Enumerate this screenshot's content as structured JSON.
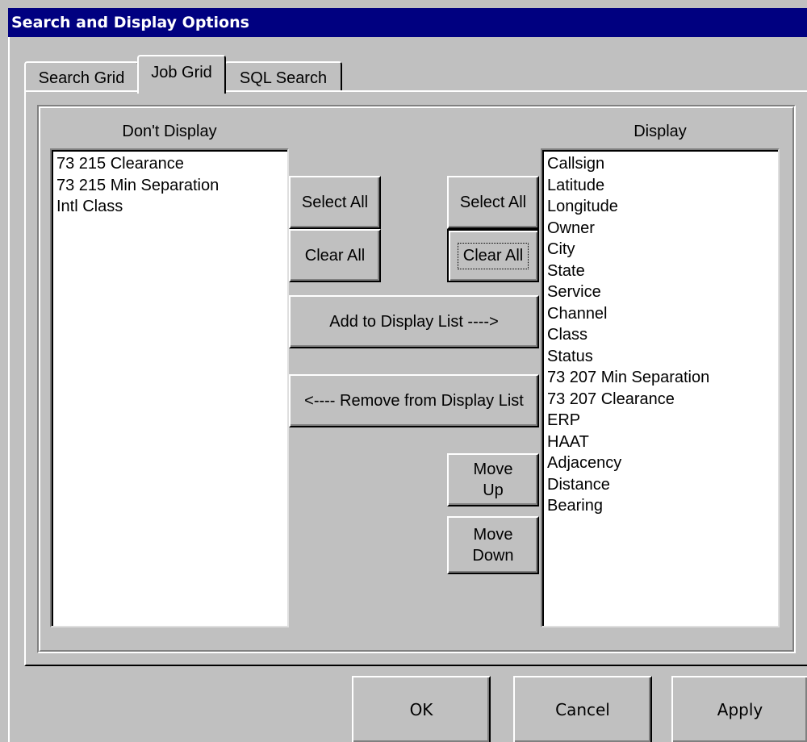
{
  "window": {
    "title": "Search and Display Options"
  },
  "tabs": [
    {
      "label": "Search Grid",
      "active": false
    },
    {
      "label": "Job Grid",
      "active": true
    },
    {
      "label": "SQL Search",
      "active": false
    }
  ],
  "left_panel": {
    "label": "Don't Display",
    "items": [
      "73 215 Clearance",
      "73 215 Min Separation",
      "Intl Class"
    ]
  },
  "right_panel": {
    "label": "Display",
    "items": [
      "Callsign",
      "Latitude",
      "Longitude",
      "Owner",
      "City",
      "State",
      "Service",
      "Channel",
      "Class",
      "Status",
      "73 207 Min Separation",
      "73 207 Clearance",
      "ERP",
      "HAAT",
      "Adjacency",
      "Distance",
      "Bearing"
    ]
  },
  "buttons": {
    "select_all_left": "Select All",
    "clear_all_left": "Clear All",
    "select_all_right": "Select All",
    "clear_all_right": "Clear All",
    "add": "Add to Display List ---->",
    "remove": "<---- Remove from Display List",
    "move_up_1": "Move",
    "move_up_2": "Up",
    "move_down_1": "Move",
    "move_down_2": "Down",
    "ok": "OK",
    "cancel": "Cancel",
    "apply": "Apply"
  },
  "colors": {
    "titlebar": "#000080",
    "face": "#c0c0c0"
  }
}
